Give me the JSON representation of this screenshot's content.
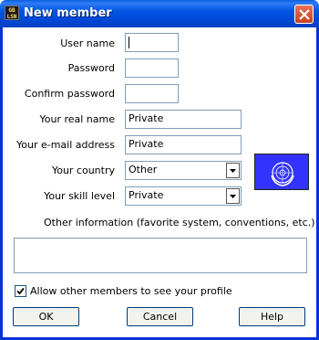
{
  "window": {
    "title": "New member",
    "app_icon_text": "GB\nLSN"
  },
  "form": {
    "username": {
      "label": "User name",
      "value": ""
    },
    "password": {
      "label": "Password",
      "value": ""
    },
    "confirm_password": {
      "label": "Confirm password",
      "value": ""
    },
    "real_name": {
      "label": "Your real name",
      "value": "Private"
    },
    "email": {
      "label": "Your e-mail address",
      "value": "Private"
    },
    "country": {
      "label": "Your country",
      "value": "Other"
    },
    "skill": {
      "label": "Your skill level",
      "value": "Private"
    },
    "other_info": {
      "label": "Other information (favorite system, conventions, etc.)",
      "value": ""
    },
    "allow_profile": {
      "label": "Allow other members to see your profile",
      "checked": true
    }
  },
  "buttons": {
    "ok": "OK",
    "cancel": "Cancel",
    "help": "Help"
  },
  "icons": {
    "close": "close-icon",
    "dropdown": "chevron-down-icon",
    "flag": "un-flag-icon",
    "checkmark": "checkmark-icon"
  },
  "colors": {
    "titlebar": "#0355e4",
    "flag_background": "#3333ff",
    "field_border": "#7f9db9",
    "button_border": "#003c74"
  }
}
